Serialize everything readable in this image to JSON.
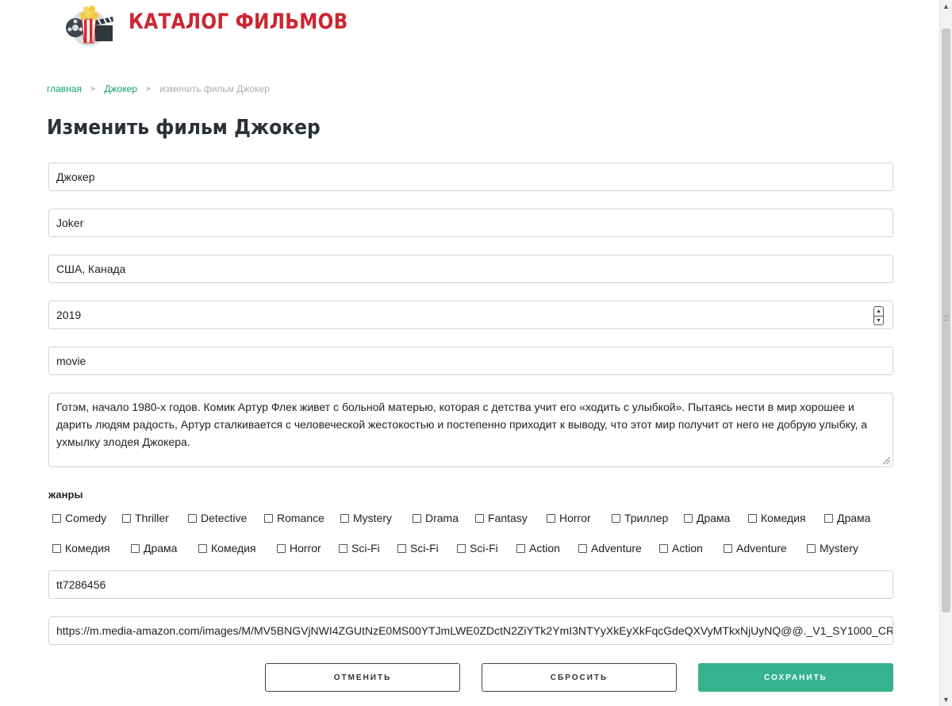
{
  "site": {
    "title": "КАТАЛОГ ФИЛЬМОВ"
  },
  "breadcrumb": {
    "home": "главная",
    "movie": "Джокер",
    "current": "изменить фильм Джокер"
  },
  "page": {
    "title": "Изменить фильм Джокер"
  },
  "form": {
    "title_ru": "Джокер",
    "title_original": "Joker",
    "country": "США, Канада",
    "year": "2019",
    "type": "movie",
    "description": "Готэм, начало 1980-х годов. Комик Артур Флек живет с больной матерью, которая с детства учит его «ходить с улыбкой». Пытаясь нести в мир хорошее и дарить людям радость, Артур сталкивается с человеческой жестокостью и постепенно приходит к выводу, что этот мир получит от него не добрую улыбку, а ухмылку злодея Джокера.",
    "genres_label": "жанры",
    "genres": [
      "Comedy",
      "Thriller",
      "Detective",
      "Romance",
      "Mystery",
      "Drama",
      "Fantasy",
      "Horror",
      "Триллер",
      "Драма",
      "Комедия",
      "Драма",
      "Комедия",
      "Драма",
      "Комедия",
      "Horror",
      "Sci-Fi",
      "Sci-Fi",
      "Sci-Fi",
      "Action",
      "Adventure",
      "Action",
      "Adventure",
      "Mystery"
    ],
    "imdb_id": "tt7286456",
    "poster_url": "https://m.media-amazon.com/images/M/MV5BNGVjNWI4ZGUtNzE0MS00YTJmLWE0ZDctN2ZiYTk2YmI3NTYyXkEyXkFqcGdeQXVyMTkxNjUyNQ@@._V1_SY1000_CR0,0,674,1000_AL_.jpg"
  },
  "buttons": {
    "cancel": "ОТМЕНИТЬ",
    "reset": "СБРОСИТЬ",
    "save": "СОХРАНИТЬ"
  },
  "icons": {
    "logo": "popcorn-film-logo-icon",
    "spinner": "number-spinner-icon",
    "resize": "resize-grip-icon"
  },
  "colors": {
    "brand": "#cc2630",
    "accent": "#34b38c",
    "link": "#12a07a"
  }
}
